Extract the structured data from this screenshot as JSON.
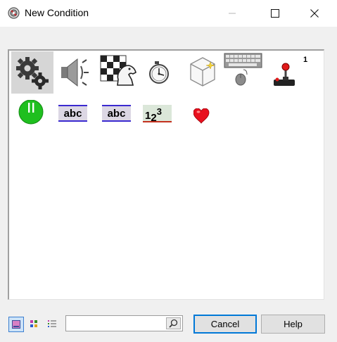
{
  "window": {
    "title": "New Condition",
    "controls": [
      "minimize-icon",
      "maximize-icon",
      "close-icon"
    ]
  },
  "object_icons": [
    {
      "name": "special-conditions-icon",
      "selected": true
    },
    {
      "name": "sound-icon"
    },
    {
      "name": "storyboard-icon"
    },
    {
      "name": "timer-icon"
    },
    {
      "name": "create-objects-icon"
    },
    {
      "name": "keyboard-mouse-icon"
    },
    {
      "name": "joystick-player-1-icon",
      "badge": "1"
    }
  ],
  "condition_icons": [
    {
      "name": "active-object-icon",
      "color": "#1fbf1f"
    },
    {
      "name": "string-abc-icon",
      "text": "abc"
    },
    {
      "name": "string-abc-icon-2",
      "text": "abc"
    },
    {
      "name": "counter-123-icon",
      "text": "123"
    },
    {
      "name": "lives-heart-icon",
      "color": "#e8101e"
    }
  ],
  "footer": {
    "view_modes": [
      "large-icons-view-icon",
      "small-icons-view-icon",
      "list-view-icon"
    ],
    "active_view": "large-icons-view-icon",
    "search": {
      "value": "",
      "placeholder": ""
    },
    "cancel_label": "Cancel",
    "help_label": "Help"
  },
  "colors": {
    "accent": "#0078d7",
    "selection": "#d6d6d6"
  }
}
